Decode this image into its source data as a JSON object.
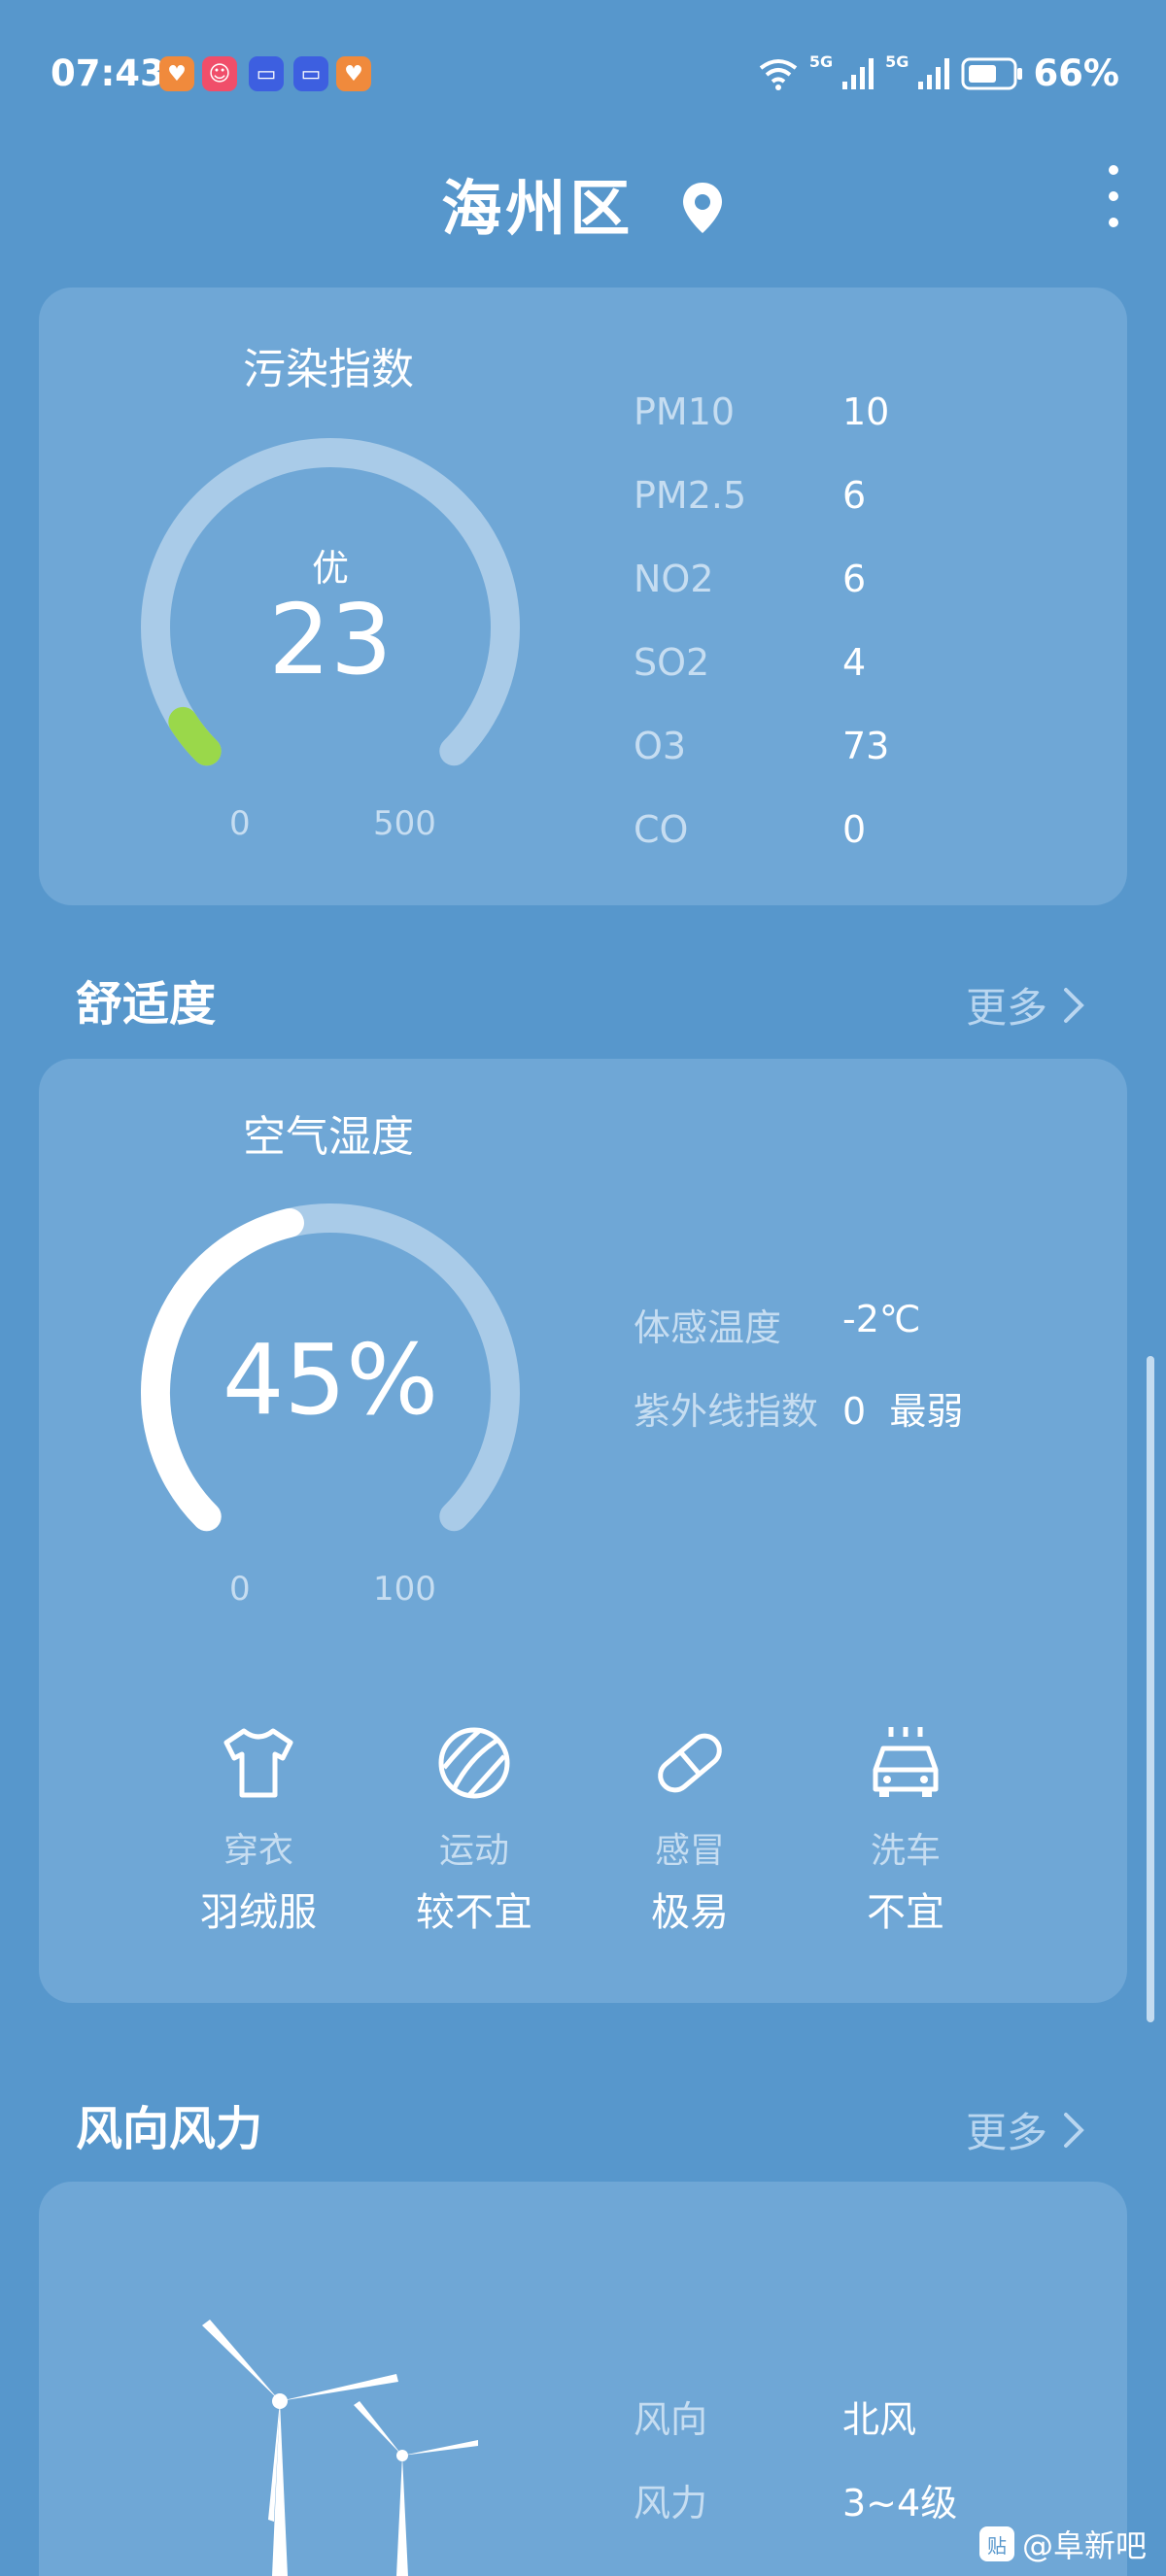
{
  "status_bar": {
    "time": "07:43",
    "battery": "66%",
    "network_1": "5G",
    "network_2": "5G",
    "app_icons": [
      "heart-app-icon",
      "meituan-app-icon",
      "bilibili-app-icon",
      "bilibili-app-icon",
      "heart-app-icon"
    ]
  },
  "header": {
    "city": "海州区",
    "location_icon": "location-pin-icon",
    "menu_icon": "more-vertical-icon"
  },
  "pollution": {
    "title": "污染指数",
    "level": "优",
    "value": "23",
    "min": "0",
    "max": "500",
    "fraction": 0.046,
    "items": [
      {
        "label": "PM10",
        "value": "10"
      },
      {
        "label": "PM2.5",
        "value": "6"
      },
      {
        "label": "NO2",
        "value": "6"
      },
      {
        "label": "SO2",
        "value": "4"
      },
      {
        "label": "O3",
        "value": "73"
      },
      {
        "label": "CO",
        "value": "0"
      }
    ]
  },
  "comfort": {
    "section_title": "舒适度",
    "more_label": "更多",
    "gauge_title": "空气湿度",
    "humidity": "45%",
    "humidity_fraction": 0.45,
    "min": "0",
    "max": "100",
    "details": [
      {
        "label": "体感温度",
        "value": "-2℃"
      },
      {
        "label": "紫外线指数",
        "value": "0  最弱"
      }
    ],
    "life_indices": [
      {
        "icon": "tshirt-icon",
        "label": "穿衣",
        "value": "羽绒服"
      },
      {
        "icon": "ball-icon",
        "label": "运动",
        "value": "较不宜"
      },
      {
        "icon": "pill-icon",
        "label": "感冒",
        "value": "极易"
      },
      {
        "icon": "car-wash-icon",
        "label": "洗车",
        "value": "不宜"
      }
    ]
  },
  "wind": {
    "section_title": "风向风力",
    "more_label": "更多",
    "direction_label": "风向",
    "direction_value": "北风",
    "force_label": "风力",
    "force_value": "3~4级"
  },
  "watermark": {
    "text": "@阜新吧",
    "badge": "贴"
  },
  "colors": {
    "background": "#5797cc",
    "card": "#6fa7d6",
    "gauge_track": "#a9cbe8",
    "pollution_fill": "#9ad84a",
    "humidity_fill": "#ffffff"
  }
}
